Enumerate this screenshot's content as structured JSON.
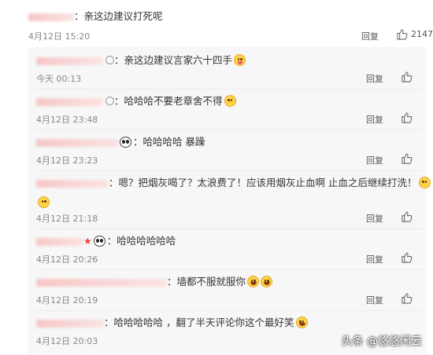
{
  "main": {
    "text": "亲这边建议打死呢",
    "time": "4月12日 15:20",
    "reply": "回复",
    "likes": "2147"
  },
  "replies": [
    {
      "text": "亲这边建议言家六十四手",
      "time": "今天 00:13",
      "reply": "回复",
      "likes": ""
    },
    {
      "text": "哈哈哈不要老章舍不得",
      "time": "4月12日 23:48",
      "reply": "回复",
      "likes": ""
    },
    {
      "text": "哈哈哈哈  暴躁",
      "time": "4月12日 23:23",
      "reply": "回复",
      "likes": ""
    },
    {
      "text": "嗯？把烟灰喝了？太浪费了！应该用烟灰止血啊 止血之后继续打洗！",
      "time": "4月12日 21:18",
      "reply": "回复",
      "likes": ""
    },
    {
      "text": "哈哈哈哈哈哈",
      "time": "4月12日 20:26",
      "reply": "回复",
      "likes": ""
    },
    {
      "text": "墙都不服就服你",
      "time": "4月12日 20:19",
      "reply": "回复",
      "likes": ""
    },
    {
      "text": "哈哈哈哈哈 ，翻了半天评论你这个最好笑",
      "time": "4月12日 20:03",
      "reply": "回复",
      "likes": ""
    }
  ],
  "watermark": "头条 @悠悠闲云",
  "icons": {
    "like": "thumbs-up-icon",
    "panda": "panda-emoji-icon",
    "smile": "smile-emoji-icon"
  }
}
